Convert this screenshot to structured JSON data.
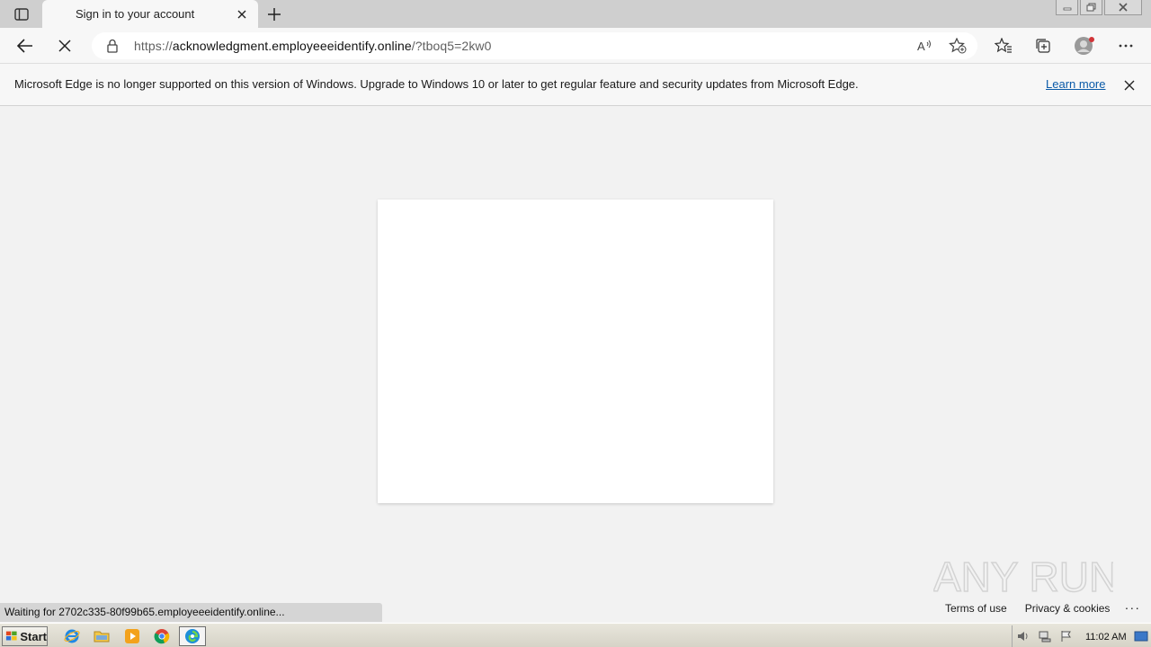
{
  "tab": {
    "title": "Sign in to your account"
  },
  "address_bar": {
    "url_prefix": "https://",
    "url_host": "acknowledgment.employeeeidentify.online",
    "url_rest": "/?tboq5=2kw0"
  },
  "infobar": {
    "message": "Microsoft Edge is no longer supported on this version of Windows. Upgrade to Windows 10 or later to get regular feature and security updates from Microsoft Edge.",
    "link": "Learn more"
  },
  "footer": {
    "terms": "Terms of use",
    "privacy": "Privacy & cookies",
    "more": "..."
  },
  "status": {
    "text": "Waiting for 2702c335-80f99b65.employeeeidentify.online..."
  },
  "watermark": {
    "text": "ANY RUN"
  },
  "taskbar": {
    "start_label": "Start",
    "clock": "11:02 AM",
    "apps": [
      "ie-icon",
      "explorer-folder-icon",
      "media-player-icon",
      "chrome-icon",
      "edge-icon"
    ]
  },
  "colors": {
    "link": "#0a5aa8",
    "page_bg": "#f2f2f2",
    "card_bg": "#ffffff"
  }
}
